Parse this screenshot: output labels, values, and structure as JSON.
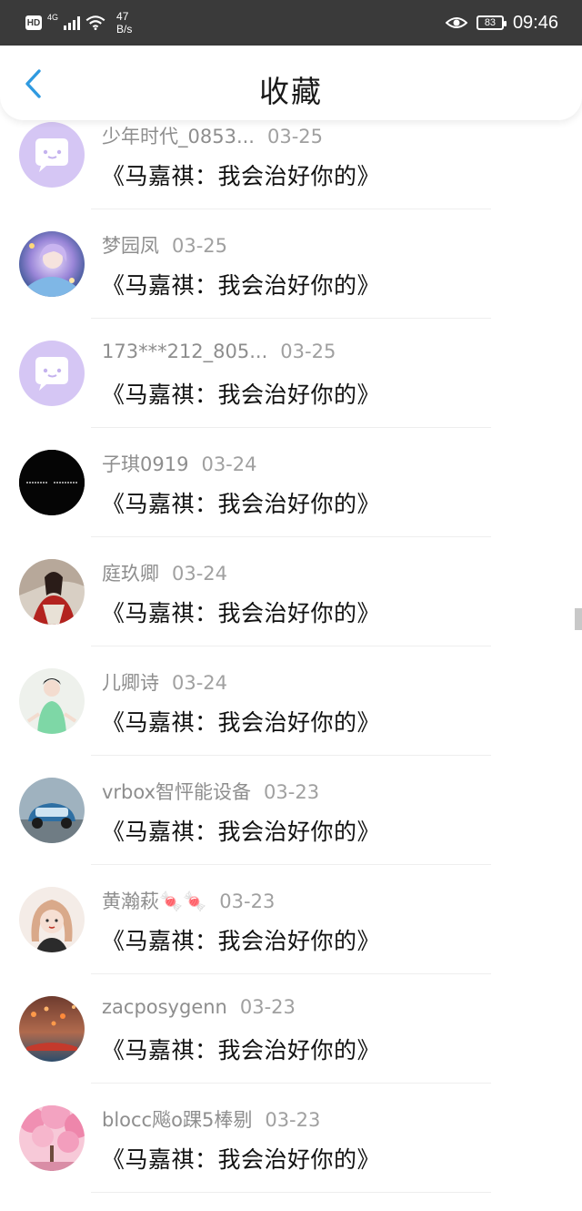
{
  "status_bar": {
    "hd": "HD",
    "network": "4G",
    "speed_value": "47",
    "speed_unit": "B/s",
    "battery": "83",
    "time": "09:46"
  },
  "header": {
    "title": "收藏"
  },
  "items": [
    {
      "user": "少年时代_0853...",
      "date": "03-25",
      "title": "《马嘉祺：我会治好你的》",
      "avatar": "chat-bubble-icon"
    },
    {
      "user": "梦园凤",
      "date": "03-25",
      "title": "《马嘉祺：我会治好你的》",
      "avatar": "anime-girl-photo"
    },
    {
      "user": "173***212_805...",
      "date": "03-25",
      "title": "《马嘉祺：我会治好你的》",
      "avatar": "chat-bubble-icon"
    },
    {
      "user": "子琪0919",
      "date": "03-24",
      "title": "《马嘉祺：我会治好你的》",
      "avatar": "black-text-photo"
    },
    {
      "user": "庭玖卿",
      "date": "03-24",
      "title": "《马嘉祺：我会治好你的》",
      "avatar": "red-robe-photo"
    },
    {
      "user": "儿卿诗",
      "date": "03-24",
      "title": "《马嘉祺：我会治好你的》",
      "avatar": "green-dress-photo"
    },
    {
      "user": "vrbox智怦能设备",
      "date": "03-23",
      "title": "《马嘉祺：我会治好你的》",
      "avatar": "car-photo"
    },
    {
      "user": "黄瀚萩🍬🍬",
      "date": "03-23",
      "title": "《马嘉祺：我会治好你的》",
      "avatar": "cartoon-girl-photo"
    },
    {
      "user": "zacposygenn",
      "date": "03-23",
      "title": "《马嘉祺：我会治好你的》",
      "avatar": "lanterns-photo"
    },
    {
      "user": "blocc飚o踝5棒剔",
      "date": "03-23",
      "title": "《马嘉祺：我会治好你的》",
      "avatar": "blossom-photo"
    }
  ]
}
